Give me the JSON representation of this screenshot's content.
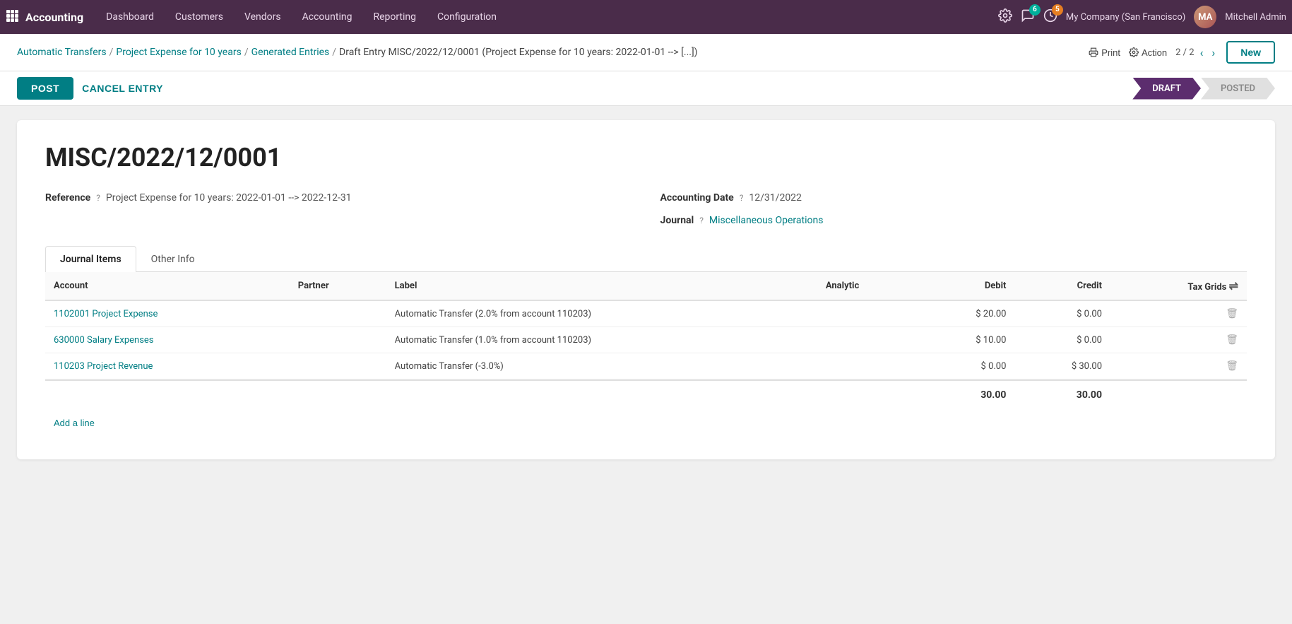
{
  "topnav": {
    "brand": "Accounting",
    "menu_items": [
      "Dashboard",
      "Customers",
      "Vendors",
      "Accounting",
      "Reporting",
      "Configuration"
    ],
    "notifications_count": "6",
    "activity_count": "5",
    "company": "My Company (San Francisco)",
    "username": "Mitchell Admin",
    "avatar_initials": "MA"
  },
  "breadcrumb": {
    "links": [
      "Automatic Transfers",
      "Project Expense for 10 years",
      "Generated Entries"
    ],
    "current": "Draft Entry MISC/2022/12/0001 (Project Expense for 10 years: 2022-01-01 --> [...])",
    "print_label": "Print",
    "action_label": "Action",
    "pagination": "2 / 2",
    "new_label": "New"
  },
  "action_bar": {
    "post_label": "POST",
    "cancel_label": "CANCEL ENTRY"
  },
  "status": {
    "active": "DRAFT",
    "inactive": "POSTED"
  },
  "form": {
    "title": "MISC/2022/12/0001",
    "reference_label": "Reference",
    "reference_value": "Project Expense for 10 years: 2022-01-01 --> 2022-12-31",
    "accounting_date_label": "Accounting Date",
    "accounting_date_value": "12/31/2022",
    "journal_label": "Journal",
    "journal_value": "Miscellaneous Operations"
  },
  "tabs": [
    {
      "id": "journal-items",
      "label": "Journal Items",
      "active": true
    },
    {
      "id": "other-info",
      "label": "Other Info",
      "active": false
    }
  ],
  "table": {
    "headers": [
      {
        "key": "account",
        "label": "Account",
        "align": "left"
      },
      {
        "key": "partner",
        "label": "Partner",
        "align": "left"
      },
      {
        "key": "label",
        "label": "Label",
        "align": "left"
      },
      {
        "key": "analytic",
        "label": "Analytic",
        "align": "left"
      },
      {
        "key": "debit",
        "label": "Debit",
        "align": "right"
      },
      {
        "key": "credit",
        "label": "Credit",
        "align": "right"
      },
      {
        "key": "taxgrids",
        "label": "Tax Grids",
        "align": "right"
      }
    ],
    "rows": [
      {
        "account": "1102001 Project Expense",
        "partner": "",
        "label": "Automatic Transfer (2.0% from account 110203)",
        "analytic": "",
        "debit": "$ 20.00",
        "credit": "$ 0.00"
      },
      {
        "account": "630000 Salary Expenses",
        "partner": "",
        "label": "Automatic Transfer (1.0% from account 110203)",
        "analytic": "",
        "debit": "$ 10.00",
        "credit": "$ 0.00"
      },
      {
        "account": "110203 Project Revenue",
        "partner": "",
        "label": "Automatic Transfer (-3.0%)",
        "analytic": "",
        "debit": "$ 0.00",
        "credit": "$ 30.00"
      }
    ],
    "add_line_label": "Add a line",
    "total_debit": "30.00",
    "total_credit": "30.00"
  }
}
